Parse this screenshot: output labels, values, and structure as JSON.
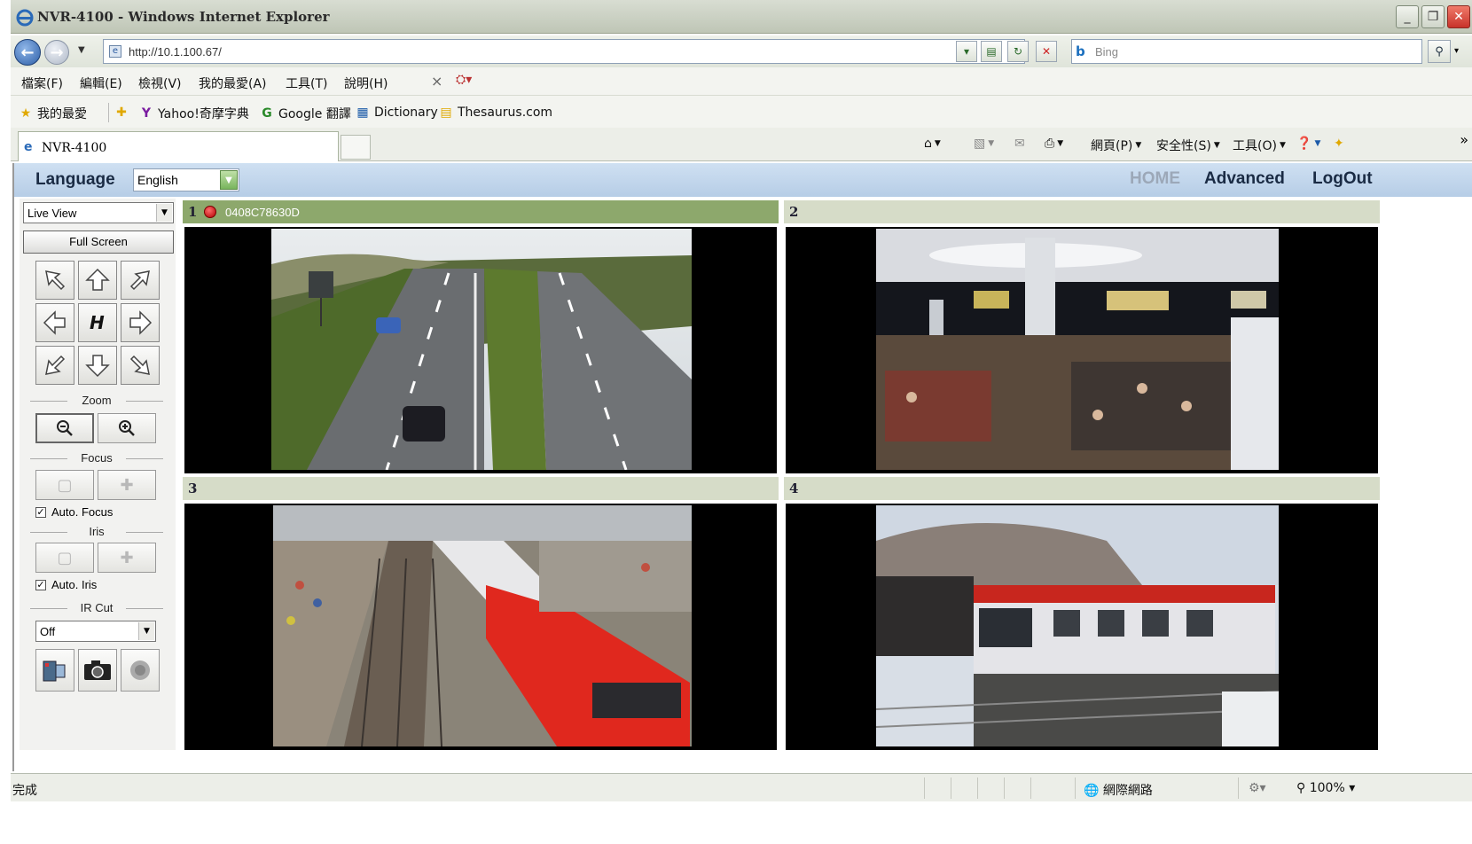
{
  "window": {
    "title": "NVR-4100 - Windows Internet Explorer"
  },
  "address": {
    "url": "http://10.1.100.67/",
    "search_placeholder": "Bing"
  },
  "menu": {
    "items": [
      "檔案(F)",
      "編輯(E)",
      "檢視(V)",
      "我的最愛(A)",
      "工具(T)",
      "說明(H)"
    ]
  },
  "favorites": {
    "label": "我的最愛",
    "items": [
      "Yahoo!奇摩字典",
      "Google 翻譯",
      "Dictionary",
      "Thesaurus.com"
    ]
  },
  "tab": {
    "label": "NVR-4100"
  },
  "commandbar": {
    "page": "網頁(P)",
    "safety": "安全性(S)",
    "tools": "工具(O)"
  },
  "app": {
    "language_label": "Language",
    "language_value": "English",
    "nav": {
      "home": "HOME",
      "advanced": "Advanced",
      "logout": "LogOut"
    },
    "view_mode": "Live View",
    "full_screen": "Full Screen",
    "zoom_label": "Zoom",
    "focus_label": "Focus",
    "auto_focus": "Auto. Focus",
    "iris_label": "Iris",
    "auto_iris": "Auto. Iris",
    "ircut_label": "IR Cut",
    "ircut_value": "Off"
  },
  "cameras": [
    {
      "number": "1",
      "id": "0408C78630D",
      "recording": true,
      "scene": "highway"
    },
    {
      "number": "2",
      "id": "",
      "recording": false,
      "scene": "airport-hall"
    },
    {
      "number": "3",
      "id": "",
      "recording": false,
      "scene": "train-station"
    },
    {
      "number": "4",
      "id": "",
      "recording": false,
      "scene": "metro-train"
    }
  ],
  "status": {
    "left": "完成",
    "zone": "網際網路",
    "zoom": "100%"
  },
  "colors": {
    "langbar": "#b6cde6",
    "active_pane_header": "#8da86c",
    "pane_header": "#d6dcc8",
    "rec": "#b10000"
  }
}
